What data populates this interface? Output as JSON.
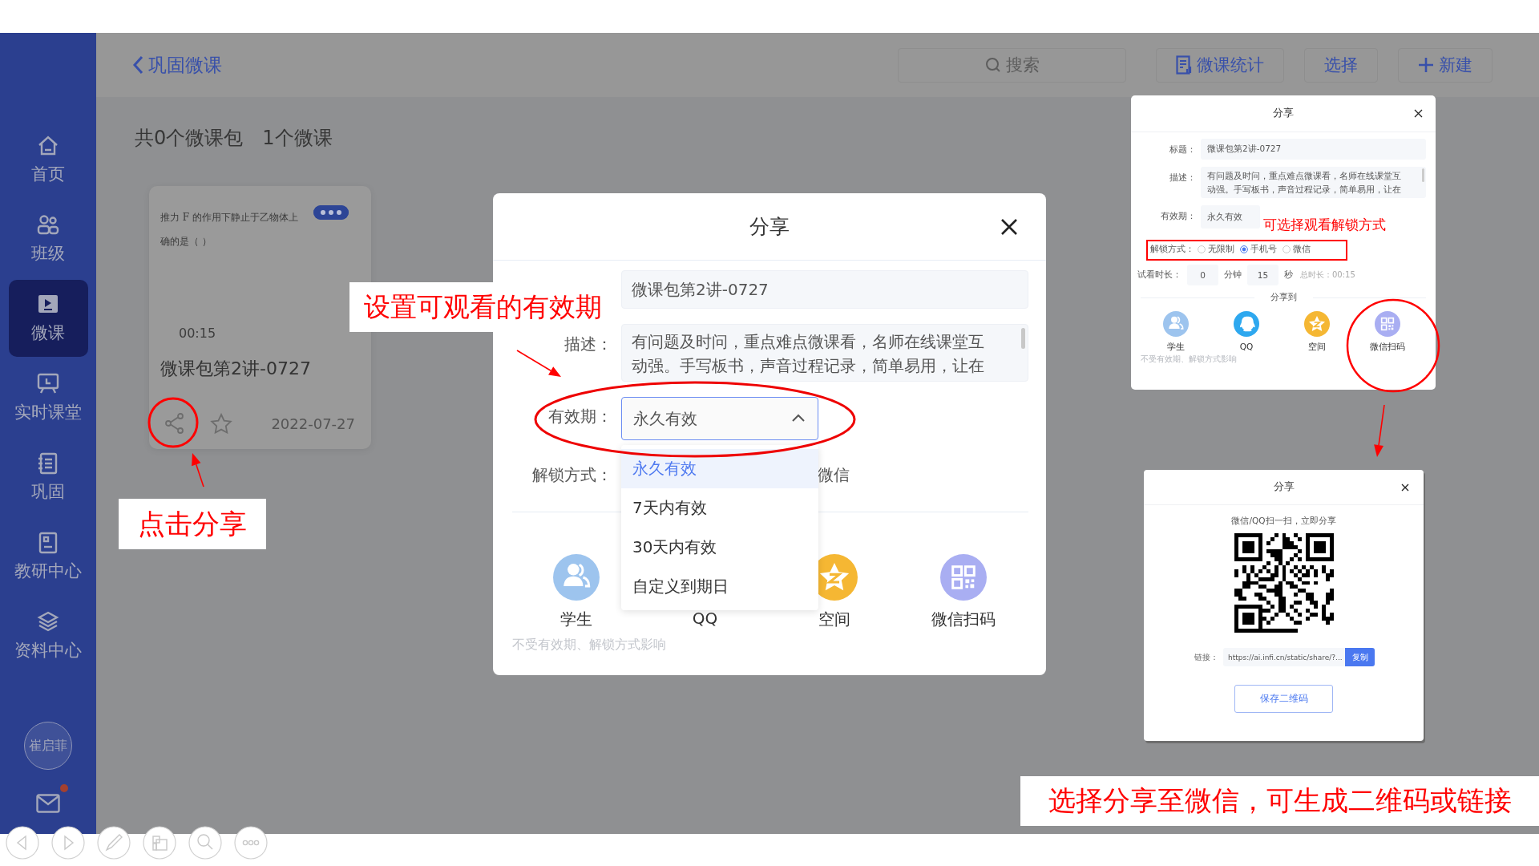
{
  "sidebar": {
    "items": [
      {
        "label": "首页",
        "selected": false
      },
      {
        "label": "班级",
        "selected": false
      },
      {
        "label": "微课",
        "selected": true
      },
      {
        "label": "实时课堂",
        "selected": false
      },
      {
        "label": "巩固",
        "selected": false
      },
      {
        "label": "教研中心",
        "selected": false
      },
      {
        "label": "资料中心",
        "selected": false
      }
    ],
    "avatar": "崔启菲",
    "mail": {
      "unread": true
    }
  },
  "header": {
    "back": "巩固微课",
    "search": {
      "placeholder": "搜索"
    },
    "buttons": [
      {
        "label": "微课统计",
        "kind": "stats"
      },
      {
        "label": "选择",
        "kind": "plain"
      },
      {
        "label": "新建",
        "kind": "add"
      }
    ]
  },
  "summary": [
    "共0个微课包",
    "1个微课"
  ],
  "card": {
    "preview_lines": [
      "推力 F 的作用下静止于乙物体上",
      "确的是（   ）"
    ],
    "duration": "00:15",
    "title": "微课包第2讲-0727",
    "date": "2022-07-27"
  },
  "share_dialog": {
    "title": "分享",
    "title_value": "微课包第2讲-0727",
    "description": {
      "label": "描述：",
      "lines": [
        "有问题及时问，重点难点微课看，名师在线课堂互",
        "动强。手写板书，声音过程记录，简单易用，让在"
      ]
    },
    "period": {
      "label": "有效期：",
      "value": "永久有效",
      "expanded": true,
      "options": [
        {
          "label": "永久有效",
          "selected": true
        },
        {
          "label": "7天内有效",
          "selected": false
        },
        {
          "label": "30天内有效",
          "selected": false
        },
        {
          "label": "自定义到期日",
          "selected": false
        }
      ]
    },
    "unlock": {
      "label": "解锁方式：",
      "visible_option": "微信"
    },
    "targets": [
      {
        "label": "学生",
        "kind": "student"
      },
      {
        "label": "QQ",
        "kind": "qq"
      },
      {
        "label": "空间",
        "kind": "qzone"
      },
      {
        "label": "微信扫码",
        "kind": "wechat"
      }
    ],
    "note": "不受有效期、解锁方式影响"
  },
  "mini_dialog": {
    "title": "分享",
    "title_label": "标题：",
    "title_value": "微课包第2讲-0727",
    "description": {
      "label": "描述：",
      "lines": [
        "有问题及时问，重点难点微课看，名师在线课堂互",
        "动强。手写板书，声音过程记录，简单易用，让在"
      ]
    },
    "period": {
      "label": "有效期：",
      "value": "永久有效"
    },
    "unlock": {
      "label": "解锁方式：",
      "options": [
        {
          "label": "无限制",
          "selected": false
        },
        {
          "label": "手机号",
          "selected": true
        },
        {
          "label": "微信",
          "selected": false
        }
      ]
    },
    "trial": {
      "label": "试看时长：",
      "minutes": "0",
      "minutes_unit": "分钟",
      "seconds": "15",
      "seconds_unit": "秒",
      "total": "总时长：00:15"
    },
    "share_to": "分享到",
    "targets": [
      {
        "label": "学生",
        "kind": "student"
      },
      {
        "label": "QQ",
        "kind": "qq"
      },
      {
        "label": "空间",
        "kind": "qzone"
      },
      {
        "label": "微信扫码",
        "kind": "wechat"
      }
    ],
    "note": "不受有效期、解锁方式影响"
  },
  "qr_dialog": {
    "title": "分享",
    "hint": "微信/QQ扫一扫，立即分享",
    "link_label": "链接：",
    "link": "https://ai.infi.cn/static/share/?...",
    "copy": "复制",
    "save": "保存二维码"
  },
  "annotations": [
    {
      "text": "点击分享",
      "kind": "boxed"
    },
    {
      "text": "设置可观看的有效期",
      "kind": "boxed"
    },
    {
      "text": "可选择观看解锁方式",
      "kind": "plain"
    },
    {
      "text": "选择分享至微信，可生成二维码或链接",
      "kind": "boxed"
    }
  ]
}
